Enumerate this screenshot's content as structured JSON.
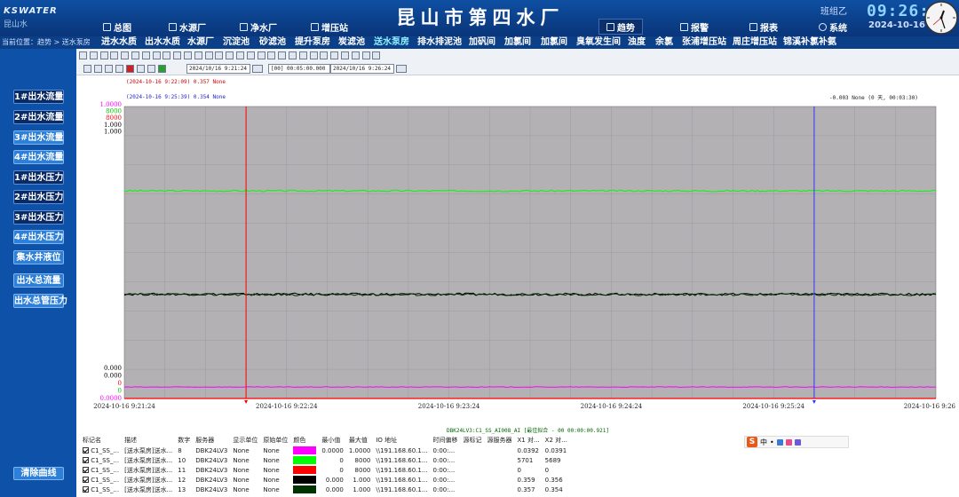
{
  "header": {
    "logo_brand": "KSWATER",
    "logo_sub": "昆山水",
    "title": "昆山市第四水厂",
    "nav_left": [
      "总图",
      "水源厂",
      "净水厂",
      "增压站"
    ],
    "nav_right": [
      "趋势",
      "报警",
      "报表",
      "系统"
    ],
    "active_nav": "趋势",
    "shift": "班组乙",
    "time": "09:26:25",
    "date": "2024-10-16"
  },
  "subnav": {
    "location": "当前位置：趋势 > 送水泵房",
    "tabs": [
      "进水水质",
      "出水水质",
      "水源厂",
      "沉淀池",
      "砂滤池",
      "提升泵房",
      "炭滤池",
      "送水泵房",
      "排水排泥池",
      "加矾间",
      "加氯间",
      "加氯间",
      "臭氧发生间",
      "浊度",
      "余氯",
      "张浦增压站",
      "周庄增压站",
      "锦溪补氯补氨"
    ],
    "active_tab": "送水泵房"
  },
  "sidebar": {
    "buttons": [
      {
        "label": "1#出水流量",
        "style": "dark"
      },
      {
        "label": "2#出水流量",
        "style": "dark"
      },
      {
        "label": "3#出水流量",
        "style": "light"
      },
      {
        "label": "4#出水流量",
        "style": "light"
      },
      {
        "label": "1#出水压力",
        "style": "dark"
      },
      {
        "label": "2#出水压力",
        "style": "dark"
      },
      {
        "label": "3#出水压力",
        "style": "dark"
      },
      {
        "label": "4#出水压力",
        "style": "light"
      },
      {
        "label": "集水井液位",
        "style": "light"
      },
      {
        "label": "出水总流量",
        "style": "light"
      },
      {
        "label": "出水总管压力",
        "style": "light"
      }
    ],
    "clear_label": "清除曲线"
  },
  "toolbar": {
    "start_time": "2024/10/16  9:21:24",
    "interval": "[00] 00:05:00.000",
    "end_time": "2024/10/16  9:26:24"
  },
  "chart": {
    "cursor1": "(2024-10-16 9:22:09) 0.357 None",
    "cursor2": "(2024-10-16 9:25:39) 0.354 None",
    "delta": "-0.003 None (0 天, 00:03:30)",
    "footer": "DBK24LV3:C1_SS_AI008_AI [最佳拟合 - 00 00:00:00.921]",
    "colors": {
      "magenta": "#ff00ff",
      "green": "#00ff00",
      "red": "#ff0000",
      "black": "#000000",
      "darkgreen": "#003300",
      "cursor1": "#ff0000",
      "cursor2": "#3333ff",
      "plotbg": "#b3b1b4"
    }
  },
  "chart_data": {
    "type": "line",
    "x_ticks": [
      "2024-10-16 9:21:24",
      "2024-10-16 9:22:24",
      "2024-10-16 9:23:24",
      "2024-10-16 9:24:24",
      "2024-10-16 9:25:24",
      "2024-10-16 9:26"
    ],
    "y_top_labels": [
      {
        "text": "1.0000",
        "color": "#ff00ff"
      },
      {
        "text": "8000",
        "color": "#00cc00"
      },
      {
        "text": "8000",
        "color": "#ff0000"
      },
      {
        "text": "1.000",
        "color": "#000000"
      },
      {
        "text": "1.000",
        "color": "#000000"
      }
    ],
    "y_bottom_labels": [
      {
        "text": "0.000",
        "color": "#000000"
      },
      {
        "text": "0.000",
        "color": "#000000"
      },
      {
        "text": "0",
        "color": "#ff0000"
      },
      {
        "text": "0",
        "color": "#00cc00"
      },
      {
        "text": "0.0000",
        "color": "#ff00ff"
      }
    ],
    "cursor_x": [
      "2024-10-16 9:22:09",
      "2024-10-16 9:25:39"
    ],
    "series": [
      {
        "color": "#00ff00",
        "level": 0.7111,
        "noise": 0.003
      },
      {
        "color": "#000000",
        "level": 0.357,
        "noise": 0.004
      },
      {
        "color": "#003300",
        "level": 0.356,
        "noise": 0.004
      },
      {
        "color": "#ff00ff",
        "level": 0.0392,
        "noise": 0.001
      },
      {
        "color": "#ff0000",
        "level": 0.0,
        "noise": 0.0
      }
    ]
  },
  "table": {
    "headers": [
      "标记名",
      "描述",
      "数字",
      "服务器",
      "显示单位",
      "原始单位",
      "颜色",
      "最小值",
      "最大值",
      "IO 地址",
      "时间偏移",
      "源标记",
      "源服务器",
      "X1 对...",
      "X2 对..."
    ],
    "rows": [
      {
        "tag": "C1_SS_...",
        "desc": "[送水泵房]送水...",
        "num": "8",
        "server": "DBK24LV3",
        "unit": "None",
        "raw": "None",
        "color": "#ff00ff",
        "min": "0.0000",
        "max": "1.0000",
        "io": "\\\\191.168.60.1...",
        "offset": "0:00:...",
        "src": "",
        "srv": "",
        "x1": "0.0392",
        "x2": "0.0391"
      },
      {
        "tag": "C1_SS_...",
        "desc": "[送水泵房]送水...",
        "num": "10",
        "server": "DBK24LV3",
        "unit": "None",
        "raw": "None",
        "color": "#00ff00",
        "min": "0",
        "max": "8000",
        "io": "\\\\191.168.60.1...",
        "offset": "0:00:...",
        "src": "",
        "srv": "",
        "x1": "5701",
        "x2": "5689"
      },
      {
        "tag": "C1_SS_...",
        "desc": "[送水泵房]送水...",
        "num": "11",
        "server": "DBK24LV3",
        "unit": "None",
        "raw": "None",
        "color": "#ff0000",
        "min": "0",
        "max": "8000",
        "io": "\\\\191.168.60.1...",
        "offset": "0:00:...",
        "src": "",
        "srv": "",
        "x1": "0",
        "x2": "0"
      },
      {
        "tag": "C1_SS_...",
        "desc": "[送水泵房]送水...",
        "num": "12",
        "server": "DBK24LV3",
        "unit": "None",
        "raw": "None",
        "color": "#000000",
        "min": "0.000",
        "max": "1.000",
        "io": "\\\\191.168.60.1...",
        "offset": "0:00:...",
        "src": "",
        "srv": "",
        "x1": "0.359",
        "x2": "0.356"
      },
      {
        "tag": "C1_SS_...",
        "desc": "[送水泵房]送水...",
        "num": "13",
        "server": "DBK24LV3",
        "unit": "None",
        "raw": "None",
        "color": "#003300",
        "min": "0.000",
        "max": "1.000",
        "io": "\\\\191.168.60.1...",
        "offset": "0:00:...",
        "src": "",
        "srv": "",
        "x1": "0.357",
        "x2": "0.354"
      }
    ]
  },
  "ime": {
    "items": [
      "中",
      "•",
      "🎤"
    ]
  }
}
